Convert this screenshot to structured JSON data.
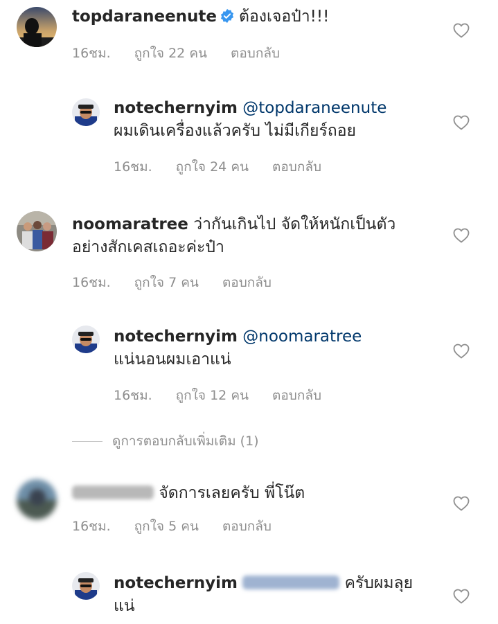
{
  "comments": [
    {
      "username": "topdaraneenute",
      "text": "ต้องเจอป๋า!!!",
      "time": "16ชม.",
      "likes": "ถูกใจ 22 คน",
      "reply": "ตอบกลับ"
    },
    {
      "username": "notechernyim",
      "mention": "@topdaraneenute",
      "text": "ผมเดินเครื่องแล้วครับ ไม่มีเกียร์ถอย",
      "time": "16ชม.",
      "likes": "ถูกใจ 24 คน",
      "reply": "ตอบกลับ"
    },
    {
      "username": "noomaratree",
      "text": "ว่ากันเกินไป จัดให้หนักเป็นตัว",
      "text2": "อย่างสักเคสเถอะค่ะป๋า",
      "time": "16ชม.",
      "likes": "ถูกใจ 7 คน",
      "reply": "ตอบกลับ"
    },
    {
      "username": "notechernyim",
      "mention": "@noomaratree",
      "text": "แน่นอนผมเอาแน่",
      "time": "16ชม.",
      "likes": "ถูกใจ 12 คน",
      "reply": "ตอบกลับ"
    },
    {
      "text": "จัดการเลยครับ พี่โน๊ต",
      "time": "16ชม.",
      "likes": "ถูกใจ 5 คน",
      "reply": "ตอบกลับ"
    },
    {
      "username": "notechernyim",
      "text": "ครับผมลุย",
      "text2": "แน่"
    }
  ],
  "view_more_replies": "ดูการตอบกลับเพิ่มเติม (1)",
  "colors": {
    "text": "#262626",
    "meta": "#8e8e8e",
    "mention": "#00376b",
    "verified": "#3897f0"
  }
}
